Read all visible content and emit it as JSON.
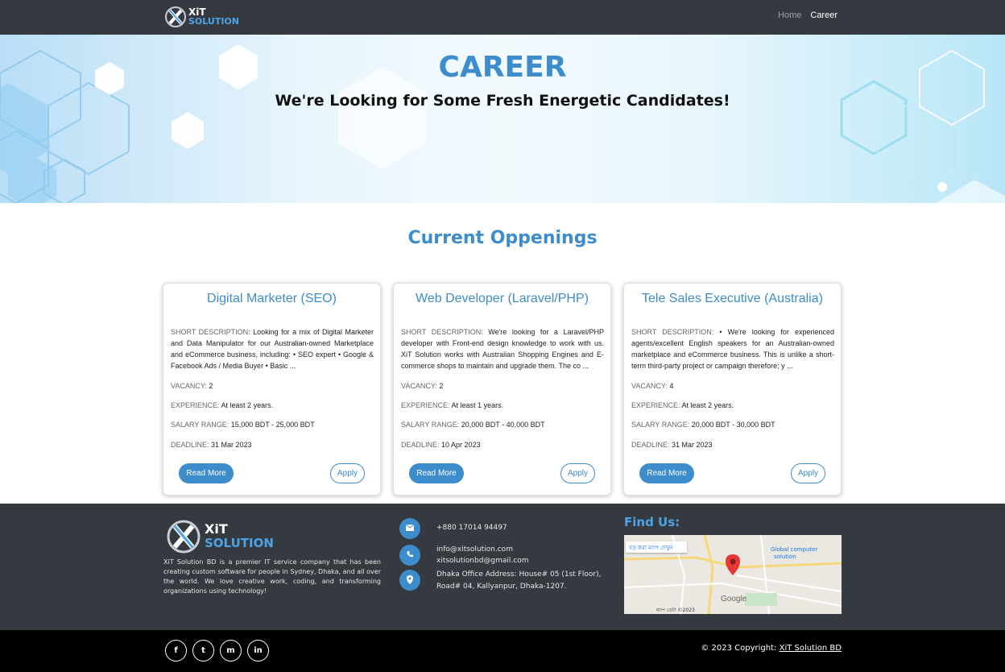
{
  "navbar": {
    "logo_top": "XiT",
    "logo_bottom": "SOLUTION",
    "links": [
      "Home",
      "Career"
    ]
  },
  "hero": {
    "title": "CAREER",
    "subtitle": "We're Looking for Some Fresh Energetic Candidates!"
  },
  "openings": {
    "title": "Current Oppenings",
    "labels": {
      "short_description": "SHORT DESCRIPTION:",
      "vacancy": "VACANCY:",
      "experience": "EXPERIENCE:",
      "salary": "SALARY RANGE:",
      "deadline": "DEADLINE:"
    },
    "jobs": [
      {
        "title": "Digital Marketer (SEO)",
        "description": "Looking for a mix of Digital Marketer and Data Manipulator for our Australian-owned Marketplace and eCommerce business, including: • SEO expert • Google & Facebook Ads / Media Buyer • Basic ...",
        "vacancy": "2",
        "experience": "At least 2 years.",
        "salary": "15,000 BDT - 25,000 BDT",
        "deadline": "31 Mar 2023",
        "read_more": "Read More",
        "apply": "Apply"
      },
      {
        "title": "Web Developer (Laravel/PHP)",
        "description": "We're looking for a Laravel/PHP developer with Front-end design knowledge to work with us. XiT Solution works with Australian Shopping Engines and E-commerce shops to maintain and upgrade them. The co ...",
        "vacancy": "2",
        "experience": "At least 1 years.",
        "salary": "20,000 BDT - 40,000 BDT",
        "deadline": "10 Apr 2023",
        "read_more": "Read More",
        "apply": "Apply"
      },
      {
        "title": "Tele Sales Executive (Australia)",
        "description": "• We're looking for experienced agents/excellent English speakers for an Australian-owned marketplace and eCommerce business. This is unlike a short-term third-party project or campaign therefore; y ...",
        "vacancy": "4",
        "experience": "At least 2 years.",
        "salary": "20,000 BDT - 30,000 BDT",
        "deadline": "31 Mar 2023",
        "read_more": "Read More",
        "apply": "Apply"
      }
    ]
  },
  "footer": {
    "logo_top": "XiT",
    "logo_bottom": "SOLUTION",
    "about": "XiT Solution BD is a premier IT service company that has been creating custom software for people in Sydney, Dhaka, and all over the world. We love creative work, coding, and transforming organizations using technology!",
    "phone": "+880 17014 94497",
    "email_1": "info@xitsolution.com",
    "email_2": "xitsolutionbd@gmail.com",
    "address_1": "Dhaka Office Address: House# 05 (1st Floor),",
    "address_2": "Road# 04, Kallyanpur, Dhaka-1207.",
    "find_us": "Find Us:",
    "map": {
      "enlarge": "বড় করা ম্যাপ দেখুন",
      "place_1": "Global computer",
      "place_2": "solution",
      "google": "Google",
      "map_data": "ম্যাপ ডেটা ©2023"
    }
  },
  "bottom": {
    "copyright_prefix": "© 2023 Copyright:",
    "copyright_link": "XiT Solution BD",
    "social": [
      "f",
      "t",
      "m",
      "in"
    ]
  }
}
